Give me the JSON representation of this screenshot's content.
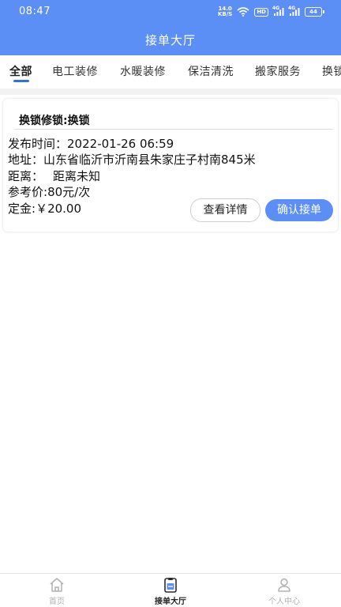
{
  "status_bar": {
    "time": "08:47",
    "speed_value": "14.0",
    "speed_unit": "KB/S",
    "hd_label": "HD",
    "signal_labels": [
      "4G",
      "4G"
    ],
    "battery_level": "44",
    "icon_names": [
      "wifi-icon",
      "hd-icon",
      "signal-icon",
      "signal-icon",
      "battery-icon"
    ]
  },
  "header": {
    "title": "接单大厅"
  },
  "tabs": [
    {
      "label": "全部",
      "active": true
    },
    {
      "label": "电工装修"
    },
    {
      "label": "水暖装修"
    },
    {
      "label": "保洁清洗"
    },
    {
      "label": "搬家服务"
    },
    {
      "label": "换锁"
    }
  ],
  "order": {
    "title": "换锁修锁:换锁",
    "publish_time": {
      "label": "发布时间：",
      "value": "2022-01-26 06:59"
    },
    "address": {
      "label": "地址：",
      "value": "山东省临沂市沂南县朱家庄子村南845米"
    },
    "distance": {
      "label": "距离：",
      "value": "距离未知"
    },
    "reference_price": {
      "label": "参考价:",
      "value": "80元/次"
    },
    "deposit": {
      "label": "定金:",
      "value": "￥20.00"
    },
    "detail_button": "查看详情",
    "accept_button": "确认接单"
  },
  "bottom_nav": [
    {
      "label": "首页",
      "icon": "home-icon"
    },
    {
      "label": "接单大厅",
      "icon": "order-hall-icon",
      "active": true
    },
    {
      "label": "个人中心",
      "icon": "person-icon"
    }
  ],
  "colors": {
    "primary": "#5b8ff6",
    "tab_indicator": "#2f6fea",
    "text": "#111111",
    "nav_inactive": "#b0b0b0"
  }
}
